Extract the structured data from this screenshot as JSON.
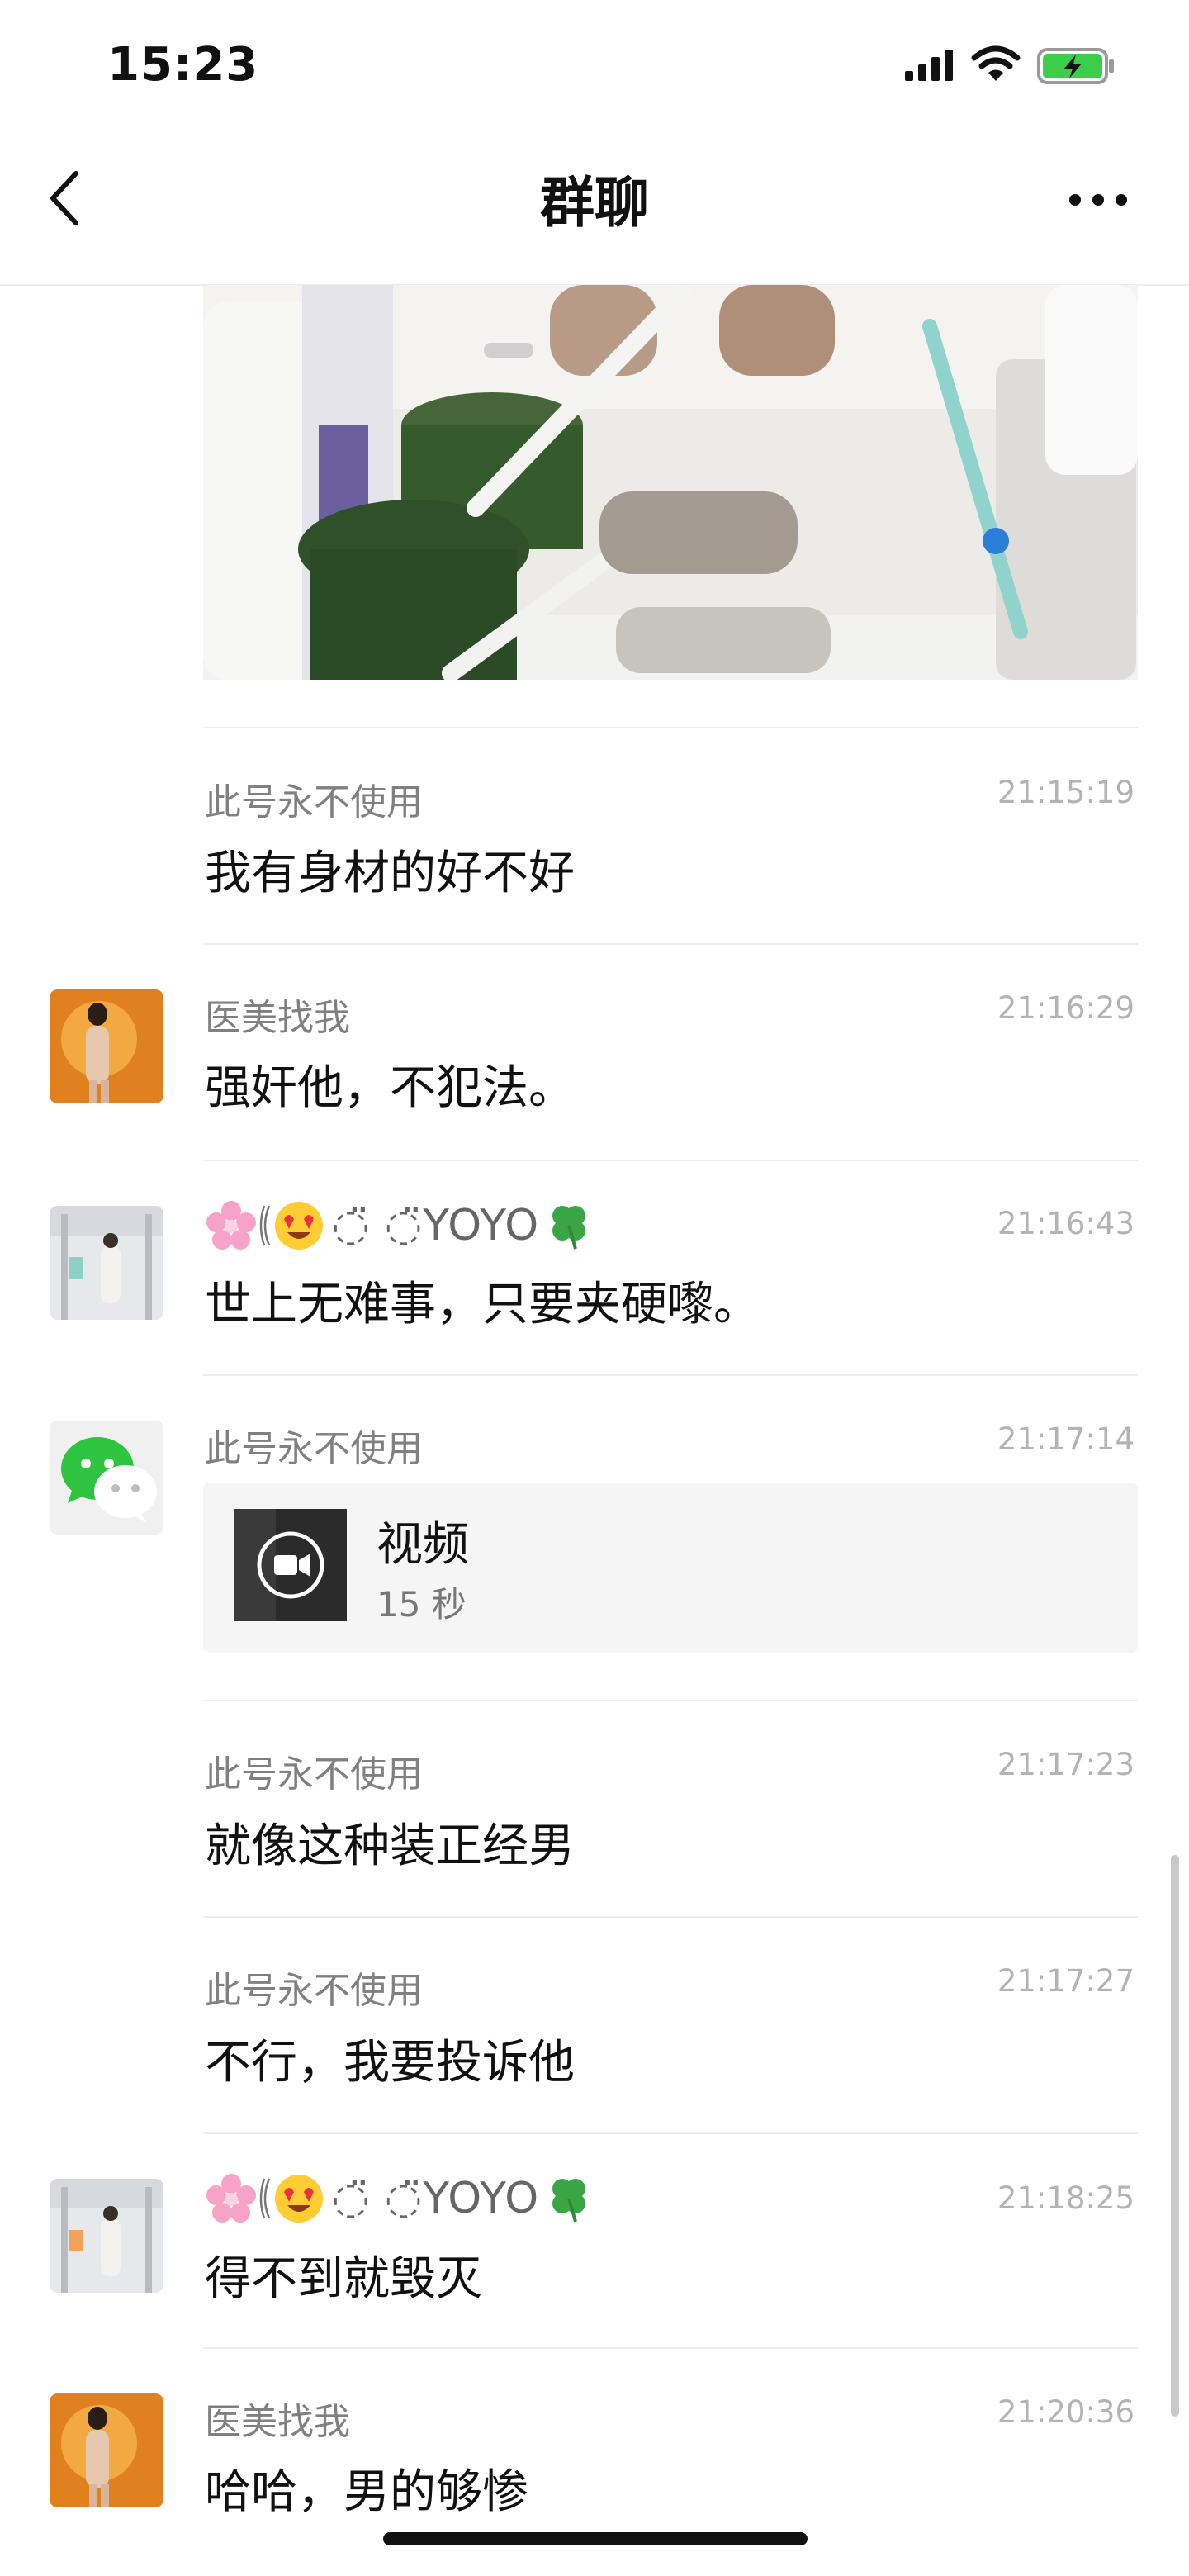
{
  "status_bar": {
    "time": "15:23"
  },
  "nav": {
    "title": "群聊"
  },
  "messages": [
    {
      "sender": "此号永不使用",
      "time": "21:15:19",
      "text": "我有身材的好不好"
    },
    {
      "sender": "医美找我",
      "time": "21:16:29",
      "text": "强奸他，不犯法。"
    },
    {
      "sender_name_text": "YOYO",
      "time": "21:16:43",
      "text": "世上无难事，只要夹硬嚟。"
    },
    {
      "sender": "此号永不使用",
      "time": "21:17:14",
      "video_label": "视频",
      "video_duration": "15 秒"
    },
    {
      "sender": "此号永不使用",
      "time": "21:17:23",
      "text": "就像这种装正经男"
    },
    {
      "sender": "此号永不使用",
      "time": "21:17:27",
      "text": "不行，我要投诉他"
    },
    {
      "sender_name_text": "YOYO",
      "time": "21:18:25",
      "text": "得不到就毁灭"
    },
    {
      "sender": "医美找我",
      "time": "21:20:36",
      "text": "哈哈，男的够惨"
    }
  ],
  "colors": {
    "wechat_green": "#2ec440",
    "battery_green": "#3ccd4b",
    "separator": "#ececec"
  },
  "icons": [
    "back-chevron",
    "more-dots",
    "signal",
    "wifi",
    "battery-charging",
    "video-camera",
    "cherry-blossom",
    "heart-eyes-emoji",
    "four-leaf-clover",
    "wechat-logo"
  ]
}
